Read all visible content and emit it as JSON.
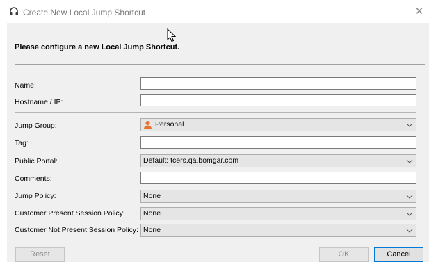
{
  "window": {
    "title": "Create New Local Jump Shortcut",
    "close_glyph": "✕",
    "icon": "headset-icon"
  },
  "heading": "Please configure a new Local Jump Shortcut.",
  "fields": {
    "name": {
      "label": "Name:",
      "value": ""
    },
    "hostname": {
      "label": "Hostname / IP:",
      "value": ""
    },
    "jump_group": {
      "label": "Jump Group:",
      "value": "Personal",
      "icon": "person-icon"
    },
    "tag": {
      "label": "Tag:",
      "value": ""
    },
    "public_portal": {
      "label": "Public Portal:",
      "value": "Default: tcers.qa.bomgar.com"
    },
    "comments": {
      "label": "Comments:",
      "value": ""
    },
    "jump_policy": {
      "label": "Jump Policy:",
      "value": "None"
    },
    "customer_present_policy": {
      "label": "Customer Present Session Policy:",
      "value": "None"
    },
    "customer_not_present_policy": {
      "label": "Customer Not Present Session Policy:",
      "value": "None"
    }
  },
  "buttons": {
    "reset": "Reset",
    "ok": "OK",
    "cancel": "Cancel"
  },
  "colors": {
    "panel_bg": "#f0f0f0",
    "accent": "#0078d7",
    "person_icon": "#e8732c"
  }
}
